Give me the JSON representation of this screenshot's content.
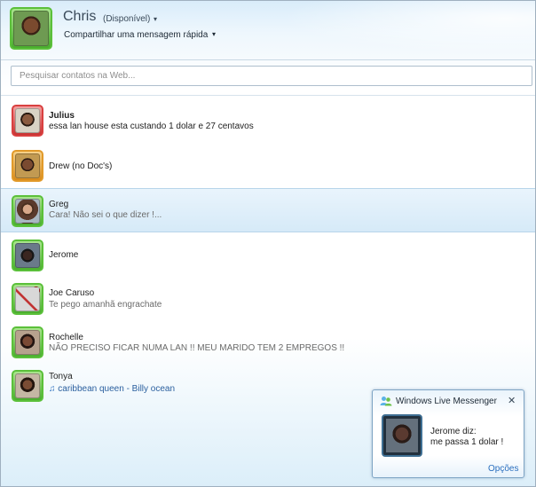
{
  "me": {
    "name": "Chris",
    "status": "(Disponível)",
    "status_caret": "▾",
    "personal_message": "Compartilhar uma mensagem rápida",
    "message_caret": "▾",
    "avatar_icon": "user-avatar-icon"
  },
  "search": {
    "placeholder": "Pesquisar contatos na Web..."
  },
  "contacts": [
    {
      "name": "Julius",
      "message": "essa lan house esta custando 1 dolar e 27 centavos",
      "status_color": "#d94040"
    },
    {
      "name": "Drew (no Doc's)",
      "message": "",
      "status_color": "#e19a2a"
    },
    {
      "name": "Greg",
      "message": "Cara! Não sei o que dizer !...",
      "status_color": "#5bc03a"
    },
    {
      "name": "Jerome",
      "message": "",
      "status_color": "#5bc03a"
    },
    {
      "name": "Joe Caruso",
      "message": "Te pego amanhã engrachate",
      "status_color": "#5bc03a"
    },
    {
      "name": "Rochelle",
      "message": "NÃO PRECISO FICAR NUMA LAN !! MEU MARIDO TEM 2 EMPREGOS !!",
      "status_color": "#5bc03a"
    },
    {
      "name": "Tonya",
      "message": "caribbean queen - Billy ocean",
      "status_color": "#5bc03a",
      "message_icon": "music-note-icon"
    }
  ],
  "toast": {
    "title": "Windows Live Messenger",
    "close": "✕",
    "line1": "Jerome diz:",
    "line2": "me passa 1 dolar !",
    "options": "Opções"
  }
}
